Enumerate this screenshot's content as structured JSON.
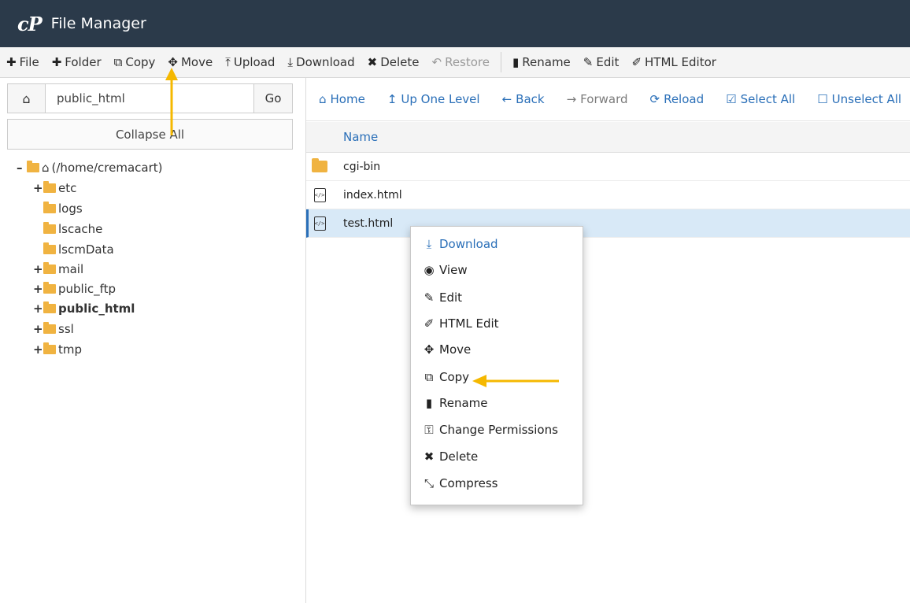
{
  "app": {
    "logo": "cP",
    "title": "File Manager"
  },
  "toolbar": [
    {
      "icon": "plus-icon",
      "glyph": "✚",
      "label": "File"
    },
    {
      "icon": "plus-icon",
      "glyph": "✚",
      "label": "Folder"
    },
    {
      "icon": "copy-icon",
      "glyph": "⧉",
      "label": "Copy"
    },
    {
      "icon": "move-icon",
      "glyph": "✥",
      "label": "Move"
    },
    {
      "icon": "upload-icon",
      "glyph": "⤒",
      "label": "Upload"
    },
    {
      "icon": "download-icon",
      "glyph": "⤓",
      "label": "Download"
    },
    {
      "icon": "delete-icon",
      "glyph": "✖",
      "label": "Delete"
    },
    {
      "icon": "restore-icon",
      "glyph": "↶",
      "label": "Restore"
    },
    {
      "icon": "rename-icon",
      "glyph": "▮",
      "label": "Rename"
    },
    {
      "icon": "edit-icon",
      "glyph": "✎",
      "label": "Edit"
    },
    {
      "icon": "html-editor-icon",
      "glyph": "✐",
      "label": "HTML Editor"
    }
  ],
  "path": {
    "value": "public_html",
    "go_label": "Go",
    "collapse_label": "Collapse All"
  },
  "tree": {
    "root": "(/home/cremacart)",
    "items": [
      {
        "label": "etc",
        "expand": "+"
      },
      {
        "label": "logs",
        "expand": ""
      },
      {
        "label": "lscache",
        "expand": ""
      },
      {
        "label": "lscmData",
        "expand": ""
      },
      {
        "label": "mail",
        "expand": "+"
      },
      {
        "label": "public_ftp",
        "expand": "+"
      },
      {
        "label": "public_html",
        "expand": "+"
      },
      {
        "label": "ssl",
        "expand": "+"
      },
      {
        "label": "tmp",
        "expand": "+"
      }
    ]
  },
  "nav": [
    {
      "glyph": "⌂",
      "label": "Home"
    },
    {
      "glyph": "↥",
      "label": "Up One Level"
    },
    {
      "glyph": "←",
      "label": "Back"
    },
    {
      "glyph": "→",
      "label": "Forward"
    },
    {
      "glyph": "⟳",
      "label": "Reload"
    },
    {
      "glyph": "☑",
      "label": "Select All"
    },
    {
      "glyph": "☐",
      "label": "Unselect All"
    }
  ],
  "table": {
    "header": "Name",
    "rows": [
      {
        "name": "cgi-bin",
        "type": "folder"
      },
      {
        "name": "index.html",
        "type": "html"
      },
      {
        "name": "test.html",
        "type": "html"
      }
    ]
  },
  "context_menu": [
    {
      "icon": "download-icon",
      "glyph": "⤓",
      "label": "Download"
    },
    {
      "icon": "view-icon",
      "glyph": "◉",
      "label": "View"
    },
    {
      "icon": "edit-icon",
      "glyph": "✎",
      "label": "Edit"
    },
    {
      "icon": "html-edit-icon",
      "glyph": "✐",
      "label": "HTML Edit"
    },
    {
      "icon": "move-icon",
      "glyph": "✥",
      "label": "Move"
    },
    {
      "icon": "copy-icon",
      "glyph": "⧉",
      "label": "Copy"
    },
    {
      "icon": "rename-icon",
      "glyph": "▮",
      "label": "Rename"
    },
    {
      "icon": "key-icon",
      "glyph": "⚿",
      "label": "Change Permissions"
    },
    {
      "icon": "delete-icon",
      "glyph": "✖",
      "label": "Delete"
    },
    {
      "icon": "compress-icon",
      "glyph": "⤡",
      "label": "Compress"
    }
  ],
  "colors": {
    "accent": "#2a6fb8",
    "titlebar": "#2b3a4a",
    "folder": "#f0b341",
    "highlight_arrow": "#f5b800"
  }
}
